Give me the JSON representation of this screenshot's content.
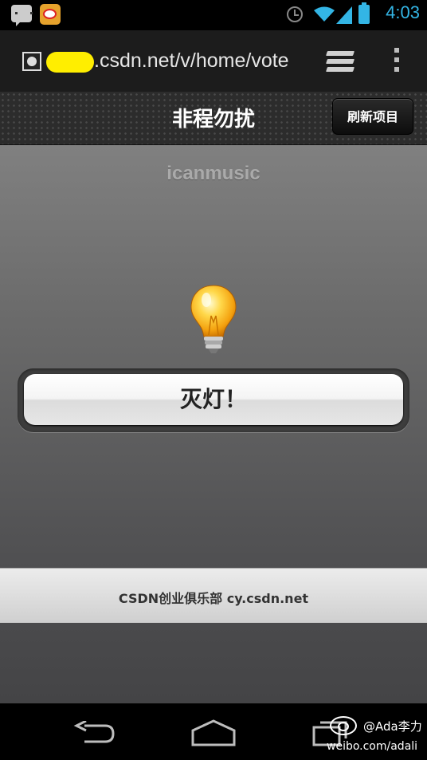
{
  "status_bar": {
    "time": "4:03",
    "icons": [
      "chat-icon",
      "weibo-icon",
      "alarm-icon",
      "wifi-icon",
      "signal-icon",
      "battery-icon"
    ],
    "accent_color": "#33b5e5"
  },
  "browser": {
    "url": ".csdn.net/v/home/vote",
    "icons": [
      "globe-icon",
      "tabs-icon",
      "menu-icon"
    ]
  },
  "header": {
    "title": "非程勿扰",
    "refresh_label": "刷新项目"
  },
  "main": {
    "username": "icanmusic",
    "toggle_label": "灭灯！",
    "icon": "lightbulb-icon"
  },
  "footer": {
    "text": "CSDN创业俱乐部 cy.csdn.net"
  },
  "navbar": {
    "icons": [
      "back-icon",
      "home-icon",
      "recent-apps-icon"
    ]
  },
  "watermark": {
    "handle": "@Ada李力",
    "url": "weibo.com/adali"
  }
}
